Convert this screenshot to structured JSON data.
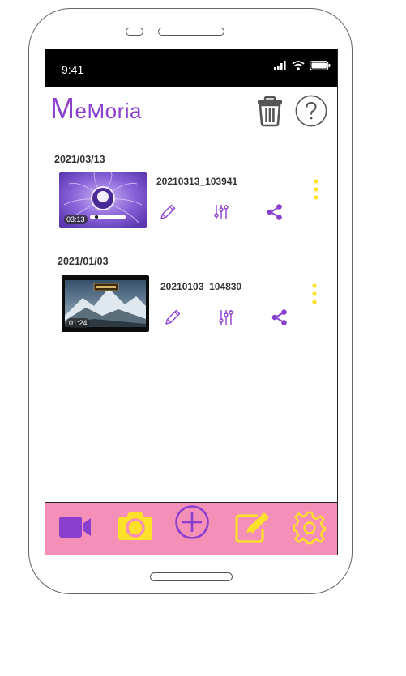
{
  "status_bar": {
    "time": "9:41"
  },
  "header": {
    "title_first": "M",
    "title_rest": "eMoria"
  },
  "groups": [
    {
      "date": "2021/03/13",
      "video": {
        "name": "20210313_103941",
        "duration": "03:13"
      }
    },
    {
      "date": "2021/01/03",
      "video": {
        "name": "20210103_104830",
        "duration": "01:24"
      }
    }
  ],
  "colors": {
    "accent": "#8b3fcf",
    "nav_background": "#f48fb8",
    "yellow": "#fde02a"
  },
  "icons": {
    "trash": "trash-icon",
    "help": "help-icon",
    "edit": "pencil-icon",
    "adjust": "sliders-icon",
    "share": "share-icon",
    "more": "more-vertical-icon",
    "nav": [
      "video-camera-icon",
      "camera-icon",
      "add-circle-icon",
      "edit-note-icon",
      "settings-icon"
    ]
  }
}
